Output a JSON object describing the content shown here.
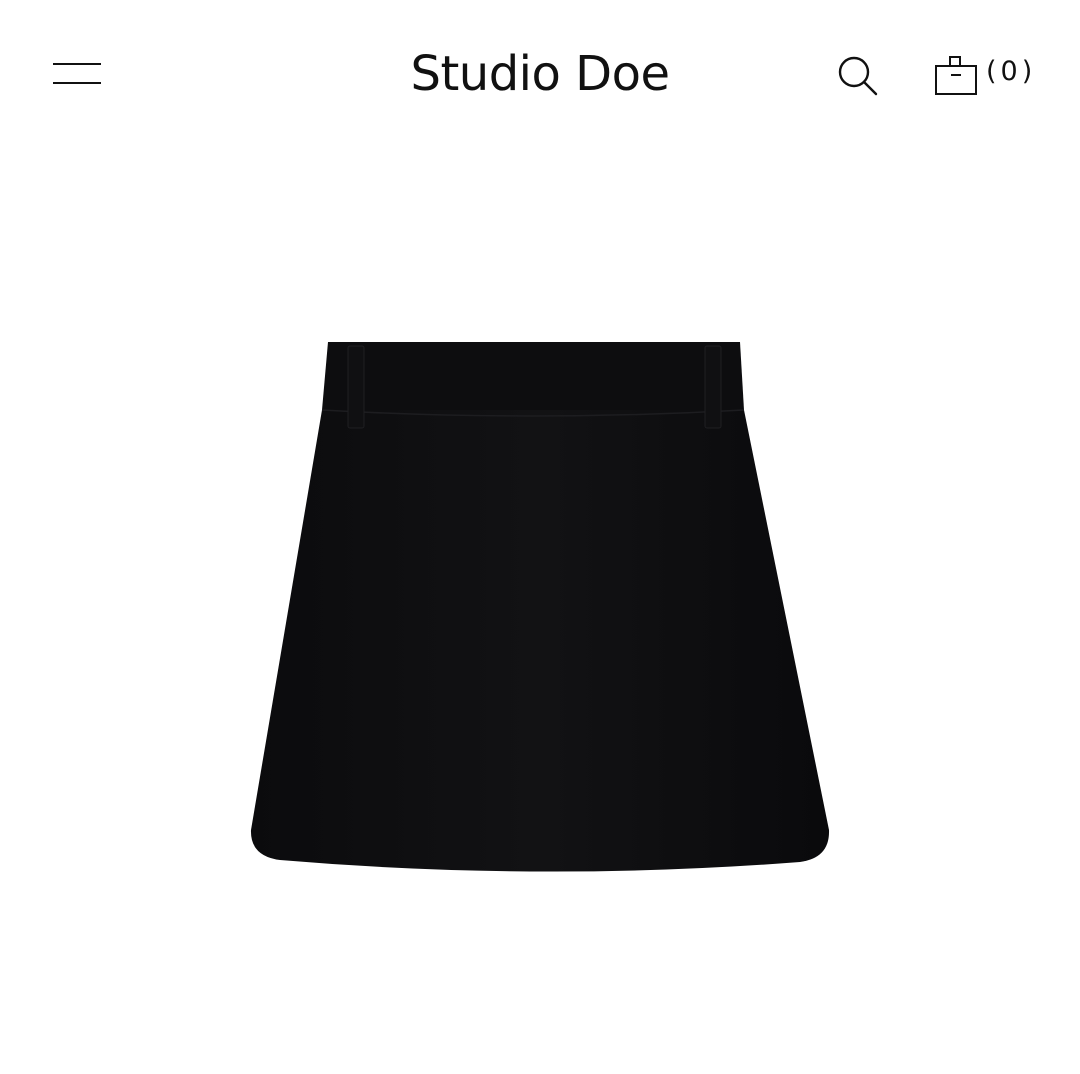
{
  "header": {
    "brand": "Studio Doe",
    "cart_count": "(0)"
  },
  "icons": {
    "menu": "hamburger-menu-icon",
    "search": "search-icon",
    "cart": "shopping-bag-icon"
  },
  "product": {
    "image_description_icon": "black-mini-skirt-image",
    "color": "#0d0d0f"
  },
  "colors": {
    "background": "#ffffff",
    "text": "#111111"
  }
}
